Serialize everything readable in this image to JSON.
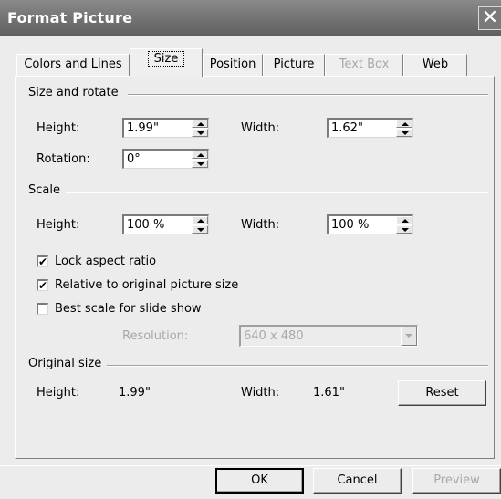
{
  "window": {
    "title": "Format Picture",
    "close_glyph": "✕"
  },
  "tabs": [
    {
      "label": "Colors and Lines"
    },
    {
      "label": "Size"
    },
    {
      "label": "Position"
    },
    {
      "label": "Picture"
    },
    {
      "label": "Text Box"
    },
    {
      "label": "Web"
    }
  ],
  "size_and_rotate": {
    "heading": "Size and rotate",
    "height_label": "Height:",
    "height_value": "1.99\"",
    "width_label": "Width:",
    "width_value": "1.62\"",
    "rotation_label": "Rotation:",
    "rotation_value": "0°"
  },
  "scale": {
    "heading": "Scale",
    "height_label": "Height:",
    "height_value": "100 %",
    "width_label": "Width:",
    "width_value": "100 %",
    "lock_aspect": {
      "label": "Lock aspect ratio",
      "checked": true
    },
    "relative_original": {
      "label": "Relative to original picture size",
      "checked": true
    },
    "best_scale": {
      "label": "Best scale for slide show",
      "checked": false
    },
    "resolution_label": "Resolution:",
    "resolution_value": "640 x 480"
  },
  "original_size": {
    "heading": "Original size",
    "height_label": "Height:",
    "height_value": "1.99\"",
    "width_label": "Width:",
    "width_value": "1.61\"",
    "reset_label": "Reset"
  },
  "buttons": {
    "ok": "OK",
    "cancel": "Cancel",
    "preview": "Preview"
  },
  "check_glyph": "✔"
}
